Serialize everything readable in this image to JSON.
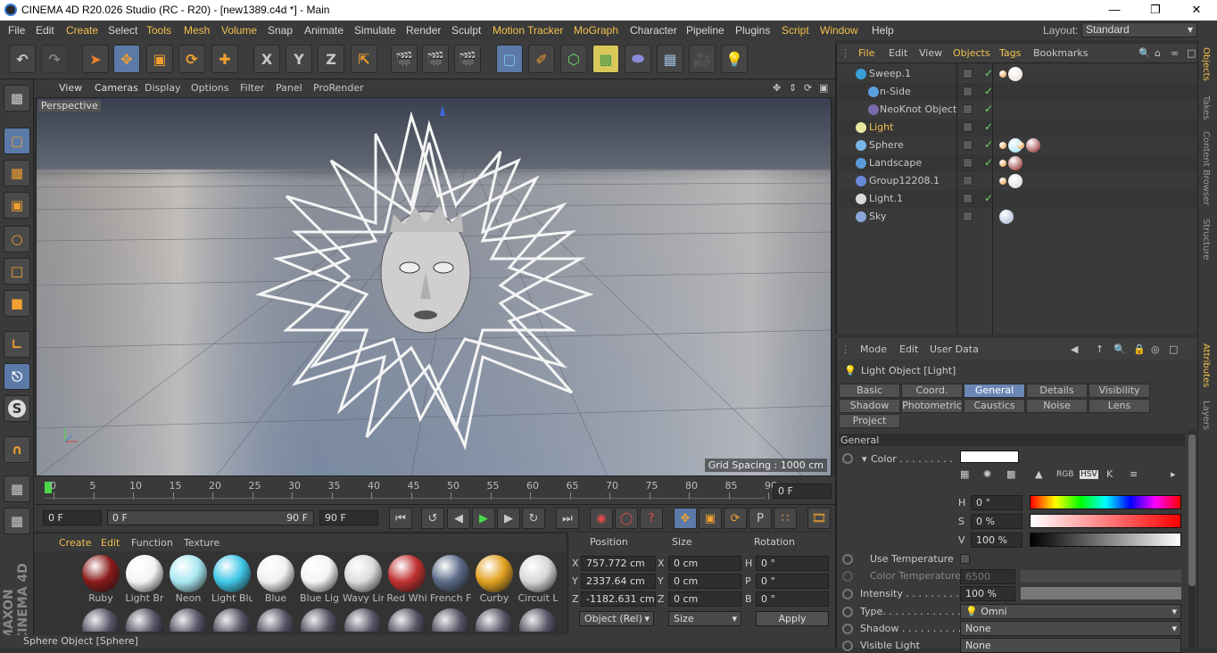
{
  "window": {
    "title": "CINEMA 4D R20.026 Studio (RC - R20) - [new1389.c4d *] - Main"
  },
  "menubar": {
    "items": [
      "File",
      "Edit",
      "Create",
      "Select",
      "Tools",
      "Mesh",
      "Volume",
      "Snap",
      "Animate",
      "Simulate",
      "Render",
      "Sculpt",
      "Motion Tracker",
      "MoGraph",
      "Character",
      "Pipeline",
      "Plugins",
      "Script",
      "Window",
      "Help"
    ],
    "layout_label": "Layout:",
    "layout_value": "Standard"
  },
  "toolbar": {
    "x": "X",
    "y": "Y",
    "z": "Z"
  },
  "viewport": {
    "menu": [
      "View",
      "Cameras",
      "Display",
      "Options",
      "Filter",
      "Panel",
      "ProRender"
    ],
    "label": "Perspective",
    "grid_spacing": "Grid Spacing : 1000 cm"
  },
  "timeline": {
    "ticks": [
      "0",
      "5",
      "10",
      "15",
      "20",
      "25",
      "30",
      "35",
      "40",
      "45",
      "50",
      "55",
      "60",
      "65",
      "70",
      "75",
      "80",
      "85",
      "90"
    ],
    "current": "0 F",
    "start": "0 F",
    "range_start": "0 F",
    "range_end": "90 F",
    "end": "90 F"
  },
  "materials": {
    "menu": [
      "Create",
      "Edit",
      "Function",
      "Texture"
    ],
    "items": [
      {
        "name": "Ruby",
        "color": "#8a1a1a"
      },
      {
        "name": "Light Br",
        "color": "#f4f4f4"
      },
      {
        "name": "Neon",
        "color": "#a8e8f2"
      },
      {
        "name": "Light Blu",
        "color": "#3fc6e6"
      },
      {
        "name": "Blue",
        "color": "#f0f0f0"
      },
      {
        "name": "Blue Lig",
        "color": "#f4f4f4"
      },
      {
        "name": "Wavy Lin",
        "color": "#dcdcdc"
      },
      {
        "name": "Red Whi",
        "color": "#c03030"
      },
      {
        "name": "French F",
        "color": "#5a6a86"
      },
      {
        "name": "Curby",
        "color": "#e0a020"
      },
      {
        "name": "Circuit L",
        "color": "#d8d8d8"
      }
    ]
  },
  "coordinates": {
    "headers": [
      "Position",
      "Size",
      "Rotation"
    ],
    "rows": [
      {
        "axis": "X",
        "pos": "757.772 cm",
        "saxis": "X",
        "size": "0 cm",
        "raxis": "H",
        "rot": "0 °"
      },
      {
        "axis": "Y",
        "pos": "2337.64 cm",
        "saxis": "Y",
        "size": "0 cm",
        "raxis": "P",
        "rot": "0 °"
      },
      {
        "axis": "Z",
        "pos": "-1182.631 cm",
        "saxis": "Z",
        "size": "0 cm",
        "raxis": "B",
        "rot": "0 °"
      }
    ],
    "mode": "Object (Rel)",
    "size_mode": "Size",
    "apply": "Apply"
  },
  "status": "Sphere Object [Sphere]",
  "objects": {
    "menu": [
      "File",
      "Edit",
      "View",
      "Objects",
      "Tags",
      "Bookmarks"
    ],
    "rows": [
      {
        "name": "Sweep.1",
        "icon": "#3aa0d8",
        "indent": 0
      },
      {
        "name": "n-Side",
        "icon": "#5aa0e0",
        "indent": 1
      },
      {
        "name": "NeoKnot Object",
        "icon": "#7a6aaa",
        "indent": 1
      },
      {
        "name": "Light",
        "icon": "#e8e8a0",
        "indent": 0
      },
      {
        "name": "Sphere",
        "icon": "#7ab6e8",
        "indent": 0
      },
      {
        "name": "Landscape",
        "icon": "#5a9ad8",
        "indent": 0
      },
      {
        "name": "Group12208.1",
        "icon": "#6a8ad8",
        "indent": 0
      },
      {
        "name": "Light.1",
        "icon": "#dadada",
        "indent": 0
      },
      {
        "name": "Sky",
        "icon": "#8aa6d8",
        "indent": 0
      }
    ]
  },
  "attributes": {
    "menu": [
      "Mode",
      "Edit",
      "User Data"
    ],
    "object_title": "Light Object [Light]",
    "tabs_row1": [
      "Basic",
      "Coord.",
      "General",
      "Details",
      "Visibility"
    ],
    "tabs_row2": [
      "Shadow",
      "Photometric",
      "Caustics",
      "Noise",
      "Lens"
    ],
    "tabs_row3": [
      "Project"
    ],
    "section": "General",
    "color_label": "Color . . . . . . . . .",
    "h_label": "H",
    "h_value": "0 °",
    "s_label": "S",
    "s_value": "0 %",
    "v_label": "V",
    "v_value": "100 %",
    "use_temperature": "Use Temperature",
    "color_temperature": "Color Temperature",
    "color_temperature_value": "6500",
    "intensity_label": "Intensity . . . . . . . . .",
    "intensity_value": "100 %",
    "type_label": "Type. . . . . . . . . . . . .",
    "type_value": "Omni",
    "shadow_label": "Shadow . . . . . . . . . .",
    "shadow_value": "None",
    "visible_light_label": "Visible Light",
    "visible_light_value": "None"
  },
  "side_tabs": [
    "Objects",
    "Takes",
    "Content Browser",
    "Structure",
    "Attributes",
    "Layers"
  ]
}
